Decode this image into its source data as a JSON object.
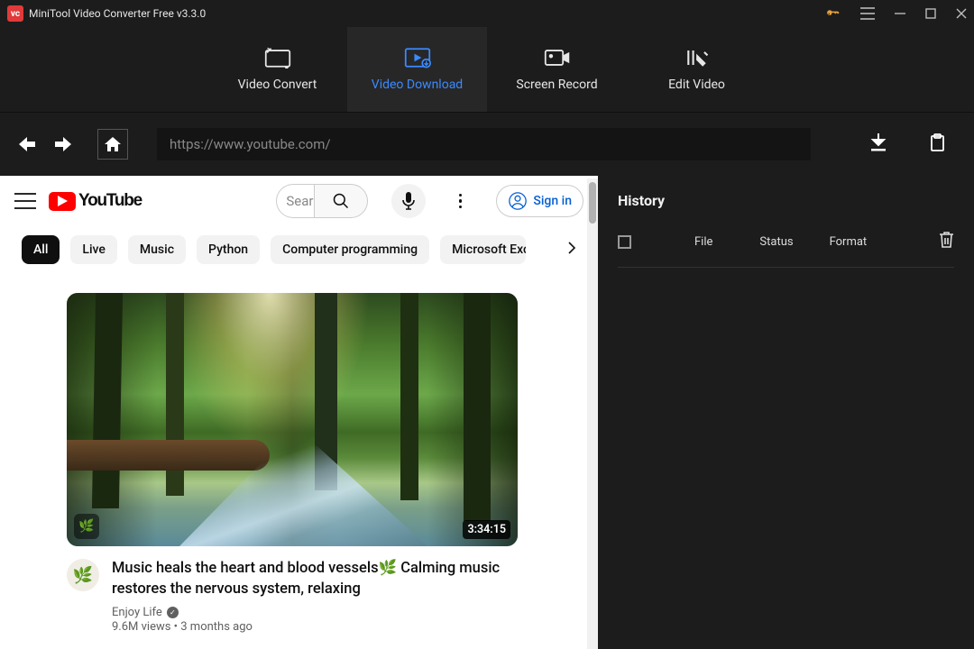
{
  "titlebar": {
    "app_title": "MiniTool Video Converter Free v3.3.0"
  },
  "tabs": {
    "video_convert": "Video Convert",
    "video_download": "Video Download",
    "screen_record": "Screen Record",
    "edit_video": "Edit Video"
  },
  "navbar": {
    "url": "https://www.youtube.com/"
  },
  "youtube": {
    "logo_text": "YouTube",
    "search_placeholder": "Search",
    "sign_in": "Sign in",
    "chips": {
      "all": "All",
      "live": "Live",
      "music": "Music",
      "python": "Python",
      "comp_prog": "Computer programming",
      "excel": "Microsoft Excel"
    },
    "video": {
      "duration": "3:34:15",
      "title": "Music heals the heart and blood vessels🌿 Calming music restores the nervous system, relaxing",
      "channel": "Enjoy Life",
      "stats": "9.6M views • 3 months ago"
    }
  },
  "history": {
    "title": "History",
    "cols": {
      "file": "File",
      "status": "Status",
      "format": "Format"
    }
  }
}
